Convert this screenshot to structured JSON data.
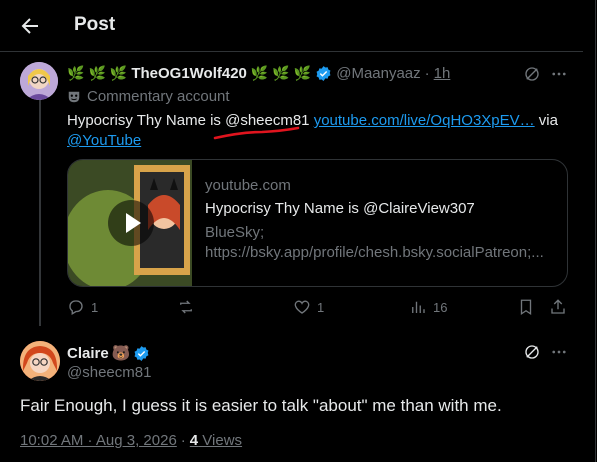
{
  "header": {
    "title": "Post"
  },
  "quoted_post": {
    "leaf_emoji": "🌿",
    "name": "TheOG1Wolf420",
    "handle": "@Maanyaaz",
    "separator": "·",
    "time": "1h",
    "commentary_label": "Commentary account",
    "text_prefix": "Hypocrisy Thy Name is @sheecm81 ",
    "link_url": "youtube.com/live/OqHO3XpEV…",
    "text_via": " via",
    "via_handle": "@YouTube",
    "card": {
      "domain": "youtube.com",
      "title": "Hypocrisy Thy Name is @ClaireView307",
      "desc_line1": "BlueSky;",
      "desc_line2": "https://bsky.app/profile/chesh.bsky.socialPatreon;..."
    },
    "actions": {
      "replies": "1",
      "reposts": "",
      "likes": "1",
      "views": "16"
    }
  },
  "main_post": {
    "name": "Claire",
    "bear_emoji": "🐻",
    "handle": "@sheecm81",
    "text": "Fair Enough, I guess it is easier to talk \"about\" me than with me.",
    "timestamp": "10:02 AM · Aug 3, 2026",
    "dot": "·",
    "views_count": "4",
    "views_label": " Views"
  },
  "colors": {
    "background": "#000000",
    "accent_link": "#1d9bf0",
    "muted": "#71767b",
    "annotation_red": "#e0141e"
  }
}
